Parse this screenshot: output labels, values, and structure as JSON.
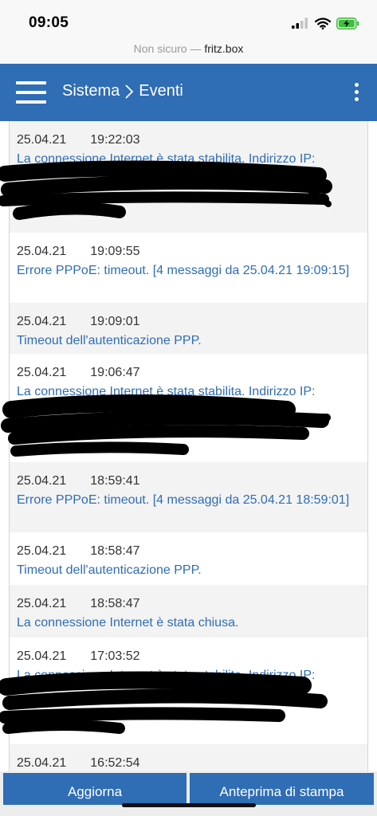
{
  "status_bar": {
    "time": "09:05"
  },
  "address_bar": {
    "security": "Non sicuro",
    "separator": " — ",
    "host": "fritz.box"
  },
  "header": {
    "section": "Sistema",
    "separator_icon": "chevron-right-icon",
    "page": "Eventi",
    "menu_icon": "hamburger-icon",
    "more_icon": "more-vertical-icon"
  },
  "events": [
    {
      "date": "25.04.21",
      "time": "19:22:03",
      "message": "La connessione Internet è stata stabilita. Indirizzo IP:"
    },
    {
      "date": "25.04.21",
      "time": "19:09:55",
      "message": "Errore PPPoE: timeout. [4 messaggi da 25.04.21 19:09:15]"
    },
    {
      "date": "25.04.21",
      "time": "19:09:01",
      "message": "Timeout dell'autenticazione PPP."
    },
    {
      "date": "25.04.21",
      "time": "19:06:47",
      "message": "La connessione Internet è stata stabilita. Indirizzo IP:"
    },
    {
      "date": "25.04.21",
      "time": "18:59:41",
      "message": "Errore PPPoE: timeout. [4 messaggi da 25.04.21 18:59:01]"
    },
    {
      "date": "25.04.21",
      "time": "18:58:47",
      "message": "Timeout dell'autenticazione PPP."
    },
    {
      "date": "25.04.21",
      "time": "18:58:47",
      "message": "La connessione Internet è stata chiusa."
    },
    {
      "date": "25.04.21",
      "time": "17:03:52",
      "message": "La connessione Internet è stata stabilita. Indirizzo IP:"
    },
    {
      "date": "25.04.21",
      "time": "16:52:54",
      "message": ""
    }
  ],
  "buttons": {
    "refresh": "Aggiorna",
    "print_preview": "Anteprima di stampa"
  },
  "colors": {
    "accent": "#2f6db5",
    "row_shade": "#f3f3f3"
  }
}
